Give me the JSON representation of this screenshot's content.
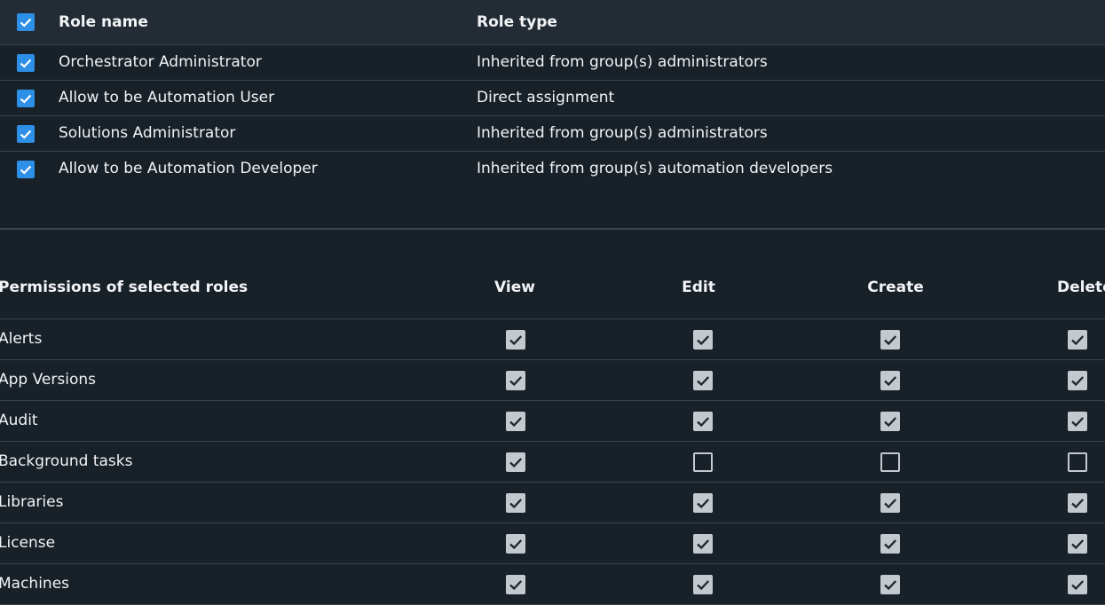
{
  "roles": {
    "header": {
      "name": "Role name",
      "type": "Role type",
      "checked": true
    },
    "rows": [
      {
        "name": "Orchestrator Administrator",
        "type": "Inherited from group(s) administrators",
        "checked": true
      },
      {
        "name": "Allow to be Automation User",
        "type": "Direct assignment",
        "checked": true
      },
      {
        "name": "Solutions Administrator",
        "type": "Inherited from group(s) administrators",
        "checked": true
      },
      {
        "name": "Allow to be Automation Developer",
        "type": "Inherited from group(s) automation developers",
        "checked": true
      }
    ]
  },
  "permissions": {
    "header": {
      "title": "Permissions of selected roles",
      "view": "View",
      "edit": "Edit",
      "create": "Create",
      "delete": "Delete"
    },
    "rows": [
      {
        "name": "Alerts",
        "view": true,
        "edit": true,
        "create": true,
        "delete": true
      },
      {
        "name": "App Versions",
        "view": true,
        "edit": true,
        "create": true,
        "delete": true
      },
      {
        "name": "Audit",
        "view": true,
        "edit": true,
        "create": true,
        "delete": true
      },
      {
        "name": "Background tasks",
        "view": true,
        "edit": false,
        "create": false,
        "delete": false
      },
      {
        "name": "Libraries",
        "view": true,
        "edit": true,
        "create": true,
        "delete": true
      },
      {
        "name": "License",
        "view": true,
        "edit": true,
        "create": true,
        "delete": true
      },
      {
        "name": "Machines",
        "view": true,
        "edit": true,
        "create": true,
        "delete": true
      }
    ]
  },
  "colors": {
    "background": "#182028",
    "header_background": "#232b34",
    "accent_checkbox": "#2e8fe6",
    "readonly_checkbox": "#c3c9ce"
  },
  "icons": {
    "checkbox_checked": "checkmark-icon"
  }
}
